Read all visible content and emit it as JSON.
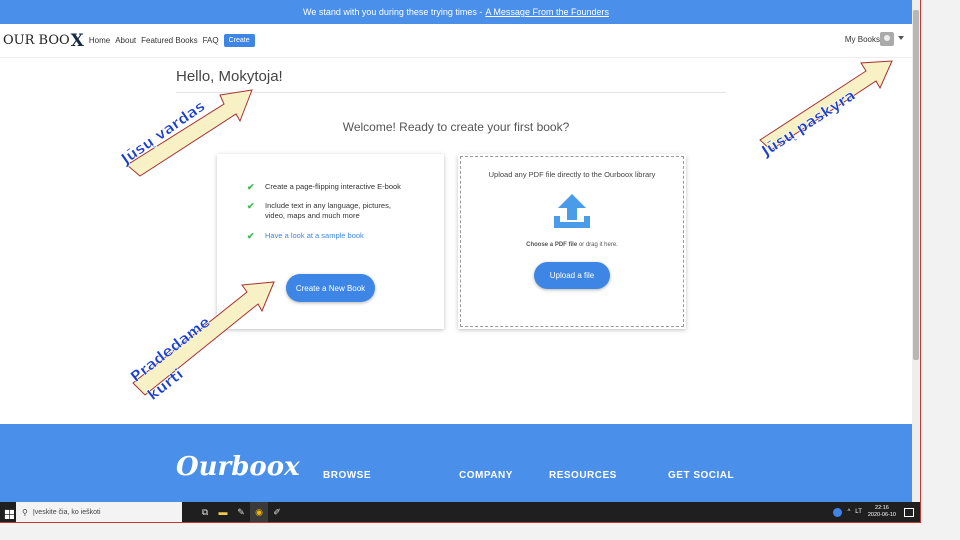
{
  "banner": {
    "text": "We stand with you during these trying times - ",
    "link": "A Message From the Founders"
  },
  "nav": {
    "logo_text": "OUR BOO",
    "logo_x": "X",
    "links": [
      "Home",
      "About",
      "Featured Books",
      "FAQ"
    ],
    "create_label": "Create",
    "my_books": "My Books"
  },
  "main": {
    "greeting": "Hello, Mokytoja!",
    "welcome": "Welcome! Ready to create your first book?"
  },
  "create_card": {
    "features": [
      "Create a page-flipping interactive E-book",
      "Include text in any language, pictures, video, maps and much more",
      "Have a look at a sample book"
    ],
    "button": "Create a New Book"
  },
  "upload_card": {
    "title": "Upload any PDF file directly to the Ourboox library",
    "hint_bold": "Choose a PDF file",
    "hint_rest": " or drag it here.",
    "button": "Upload a file"
  },
  "footer": {
    "logo": "Ourboox",
    "columns": [
      "BROWSE",
      "COMPANY",
      "RESOURCES",
      "GET SOCIAL"
    ]
  },
  "taskbar": {
    "search_placeholder": "Įveskite čia, ko ieškoti",
    "lang": "LT",
    "time": "22:16",
    "date": "2020-06-10"
  },
  "annotations": {
    "name_label": "Jūsų vardas",
    "account_label": "Jūsų paskyra",
    "start_label_1": "Pradedame",
    "start_label_2": "kurti"
  },
  "colors": {
    "accent": "#3d86e6",
    "banner": "#4a8fea",
    "arrow_fill": "#f9f1c6",
    "label": "#1a3fcf"
  }
}
